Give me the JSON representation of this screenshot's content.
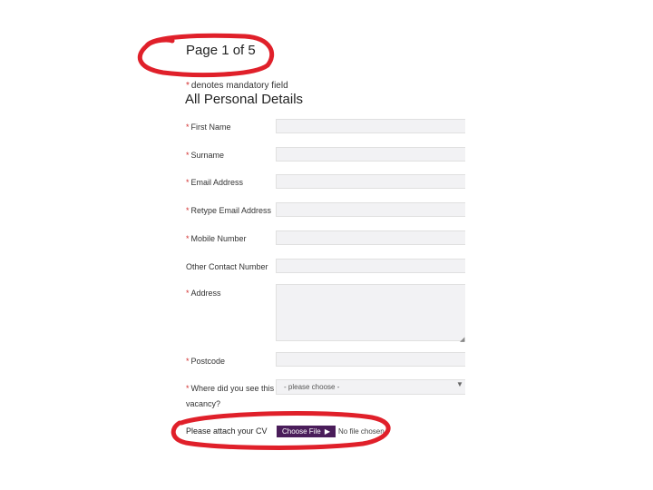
{
  "header": {
    "page_indicator": "Page 1 of 5",
    "mandatory_prefix": "*",
    "mandatory_note": "denotes mandatory field",
    "section_title": "All Personal Details"
  },
  "form": {
    "required_marker": "*",
    "first_name_label": "First Name",
    "surname_label": "Surname",
    "email_label": "Email Address",
    "retype_email_label": "Retype Email Address",
    "mobile_label": "Mobile Number",
    "other_contact_label": "Other Contact Number",
    "address_label": "Address",
    "postcode_label": "Postcode",
    "where_seen_label_line1": "Where did you see this",
    "where_seen_label_line2": "vacancy?",
    "where_seen_value": "- please choose -",
    "cv_label": "Please attach your CV",
    "choose_file_label": "Choose File",
    "no_file_text": "No file chosen"
  },
  "colors": {
    "annotation": "#e0202a",
    "button": "#4a1d5a",
    "input_bg": "#f2f2f4"
  }
}
